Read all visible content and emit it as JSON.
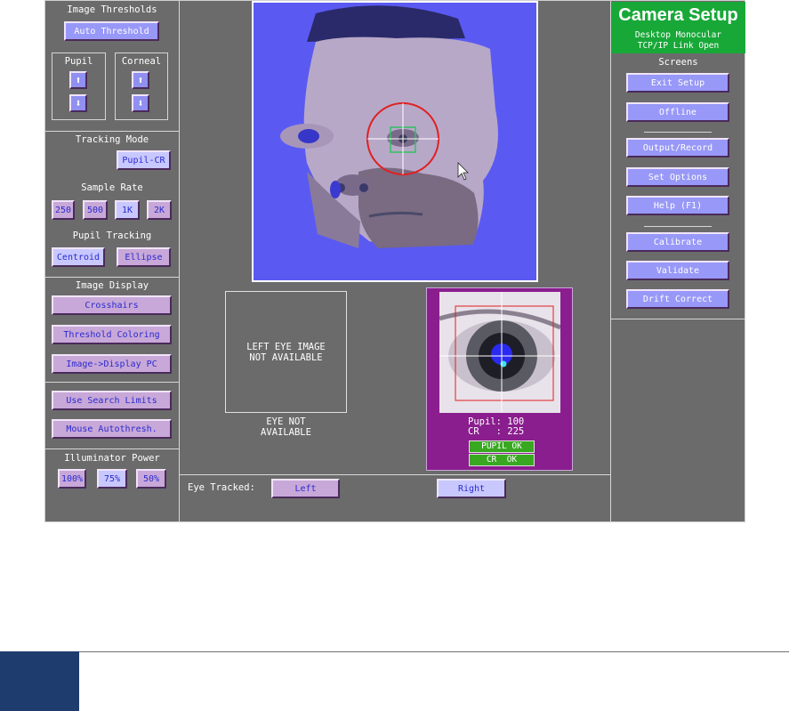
{
  "left_panel": {
    "image_thresholds": {
      "title": "Image Thresholds",
      "auto_threshold": "Auto Threshold",
      "pupil_label": "Pupil",
      "corneal_label": "Corneal",
      "up_glyph": "⬆",
      "down_glyph": "⬇"
    },
    "tracking_mode": {
      "title": "Tracking Mode",
      "value": "Pupil-CR"
    },
    "sample_rate": {
      "title": "Sample Rate",
      "options": [
        "250",
        "500",
        "1K",
        "2K"
      ],
      "selected": "1K"
    },
    "pupil_tracking": {
      "title": "Pupil Tracking",
      "options": [
        "Centroid",
        "Ellipse"
      ],
      "selected": "Centroid"
    },
    "image_display": {
      "title": "Image Display",
      "buttons": [
        "Crosshairs",
        "Threshold Coloring",
        "Image->Display PC"
      ]
    },
    "search": {
      "buttons": [
        "Use Search Limits",
        "Mouse Autothresh."
      ]
    },
    "illuminator": {
      "title": "Illuminator Power",
      "options": [
        "100%",
        "75%",
        "50%"
      ],
      "selected": "75%"
    }
  },
  "center": {
    "left_eye_message": "LEFT EYE IMAGE\nNOT AVAILABLE",
    "eye_not_available": "EYE NOT\nAVAILABLE",
    "pupil_value": "Pupil: 100",
    "cr_value": "CR   : 225",
    "pupil_status": "PUPIL OK",
    "cr_status": "CR  OK",
    "eye_tracked_label": "Eye Tracked:",
    "eye_left": "Left",
    "eye_right": "Right",
    "selected_eye": "Right"
  },
  "right_panel": {
    "title": "Camera Setup",
    "mode": "Desktop Monocular",
    "link": "TCP/IP Link Open",
    "screens_label": "Screens",
    "group1": [
      "Exit Setup",
      "Offline"
    ],
    "group2": [
      "Output/Record",
      "Set Options",
      "Help (F1)"
    ],
    "group3": [
      "Calibrate",
      "Validate",
      "Drift Correct"
    ]
  },
  "colors": {
    "background": "#6b6b6b",
    "button": "#c8a8d8",
    "button_text": "#2a2ad0",
    "camera_header": "#18a838",
    "eye_panel": "#8a1e8e",
    "status_ok": "#38a820",
    "footer_block": "#1e3c6e"
  },
  "icons": [
    "arrow-up-icon",
    "arrow-down-icon",
    "mouse-cursor-icon",
    "tracking-circle-icon",
    "crosshair-icon"
  ]
}
